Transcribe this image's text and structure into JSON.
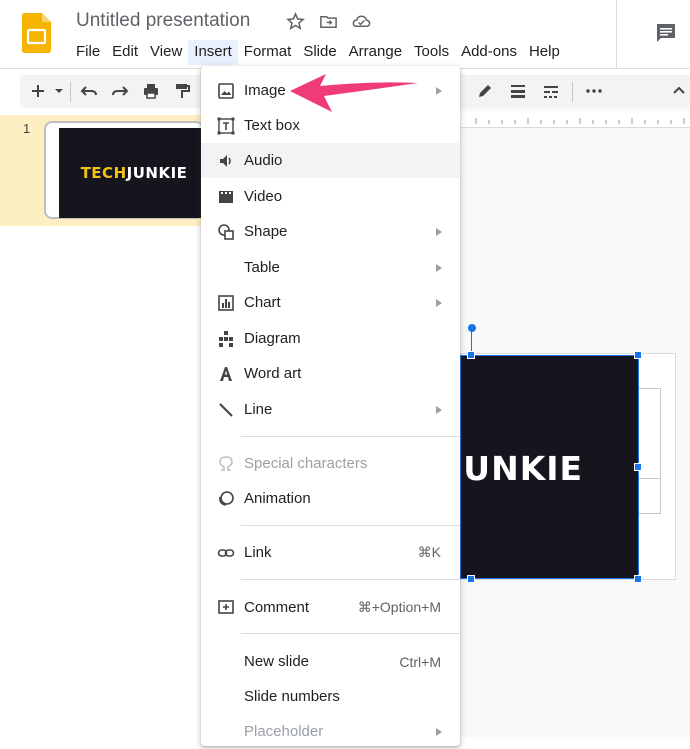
{
  "document": {
    "title": "Untitled presentation"
  },
  "menubar": [
    "File",
    "Edit",
    "View",
    "Insert",
    "Format",
    "Slide",
    "Arrange",
    "Tools",
    "Add-ons",
    "Help"
  ],
  "active_menu": "Insert",
  "filmstrip": {
    "slide_number": "1",
    "thumb_text_yellow": "TECH",
    "thumb_text_white": "JUNKIE"
  },
  "canvas": {
    "image_text": "JUNKIE"
  },
  "insert_menu": {
    "items": [
      {
        "icon": "image-icon",
        "label": "Image",
        "submenu": true
      },
      {
        "icon": "text-box-icon",
        "label": "Text box"
      },
      {
        "icon": "audio-icon",
        "label": "Audio",
        "hover": true
      },
      {
        "icon": "video-icon",
        "label": "Video"
      },
      {
        "icon": "shape-icon",
        "label": "Shape",
        "submenu": true
      },
      {
        "icon": "",
        "label": "Table",
        "submenu": true
      },
      {
        "icon": "chart-icon",
        "label": "Chart",
        "submenu": true
      },
      {
        "icon": "diagram-icon",
        "label": "Diagram"
      },
      {
        "icon": "word-art-icon",
        "label": "Word art"
      },
      {
        "icon": "line-icon",
        "label": "Line",
        "submenu": true
      },
      {
        "icon": "special-characters-icon",
        "label": "Special characters",
        "disabled": true
      },
      {
        "icon": "animation-icon",
        "label": "Animation"
      },
      {
        "icon": "link-icon",
        "label": "Link",
        "shortcut": "⌘K"
      },
      {
        "icon": "comment-icon",
        "label": "Comment",
        "shortcut": "⌘+Option+M"
      },
      {
        "icon": "",
        "label": "New slide",
        "shortcut": "Ctrl+M"
      },
      {
        "icon": "",
        "label": "Slide numbers"
      },
      {
        "icon": "",
        "label": "Placeholder",
        "submenu": true,
        "disabled": true
      }
    ]
  },
  "colors": {
    "accent": "#1a73e8",
    "annotation_arrow": "#ef3b7a",
    "slides_yellow": "#f4b400",
    "filmstrip_highlight": "#feefc3"
  }
}
